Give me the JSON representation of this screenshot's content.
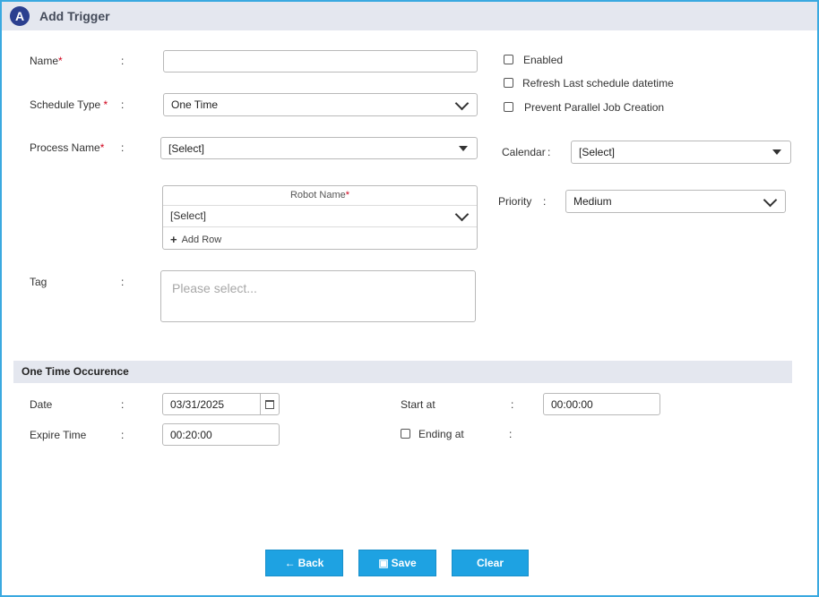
{
  "header": {
    "logo": "A",
    "title": "Add Trigger"
  },
  "form": {
    "name_label": "Name",
    "name_value": "",
    "schedule_type_label": "Schedule Type",
    "schedule_type_value": "One Time",
    "process_name_label": "Process Name",
    "process_name_value": "[Select]",
    "robot_header": "Robot Name",
    "robot_value": "[Select]",
    "add_row_label": "Add Row",
    "tag_label": "Tag",
    "tag_placeholder": "Please select...",
    "required_mark": "*",
    "colon": ":"
  },
  "options": {
    "enabled_label": "Enabled",
    "enabled_checked": false,
    "refresh_label": "Refresh Last schedule datetime",
    "refresh_checked": false,
    "prevent_label": "Prevent Parallel Job Creation",
    "prevent_checked": false,
    "calendar_label": "Calendar",
    "calendar_value": "[Select]",
    "priority_label": "Priority",
    "priority_value": "Medium"
  },
  "occurrence": {
    "section_title": "One Time Occurence",
    "date_label": "Date",
    "date_value": "03/31/2025",
    "expire_label": "Expire Time",
    "expire_value": "00:20:00",
    "start_label": "Start at",
    "start_value": "00:00:00",
    "ending_label": "Ending at",
    "ending_checked": false
  },
  "buttons": {
    "back": "Back",
    "save": "Save",
    "clear": "Clear"
  },
  "colors": {
    "accent": "#1ea2e2",
    "header_bg": "#e4e7ef",
    "frame_border": "#3aa9e0",
    "required": "#d0021b"
  },
  "icons": {
    "logo": "app-logo-icon",
    "chevron": "chevron-down-icon",
    "caret": "caret-down-icon",
    "calendar": "calendar-icon",
    "plus": "plus-icon",
    "back": "arrow-left-icon",
    "save": "floppy-disk-icon"
  }
}
